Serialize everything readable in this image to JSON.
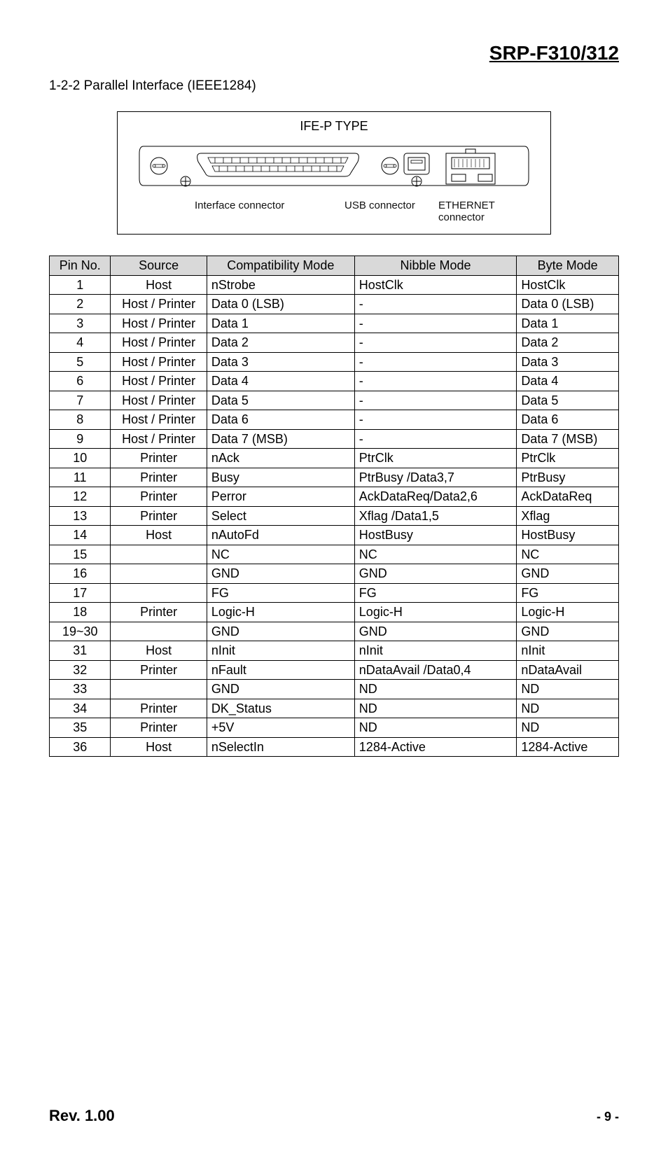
{
  "header": "SRP-F310/312",
  "sectionTitle": "1-2-2 Parallel Interface (IEEE1284)",
  "diagram": {
    "title": "IFE-P TYPE",
    "labels": {
      "interface": "Interface connector",
      "usb": "USB connector",
      "ethernet": "ETHERNET connector"
    }
  },
  "table": {
    "headers": [
      "Pin No.",
      "Source",
      "Compatibility Mode",
      "Nibble Mode",
      "Byte Mode"
    ],
    "rows": [
      {
        "pin": "1",
        "source": "Host",
        "comp": "nStrobe",
        "nibble": "HostClk",
        "byte": "HostClk"
      },
      {
        "pin": "2",
        "source": "Host / Printer",
        "comp": "Data 0 (LSB)",
        "nibble": "-",
        "byte": "Data 0 (LSB)"
      },
      {
        "pin": "3",
        "source": "Host / Printer",
        "comp": "Data 1",
        "nibble": "-",
        "byte": "Data 1"
      },
      {
        "pin": "4",
        "source": "Host / Printer",
        "comp": "Data 2",
        "nibble": "-",
        "byte": "Data 2"
      },
      {
        "pin": "5",
        "source": "Host / Printer",
        "comp": "Data 3",
        "nibble": "-",
        "byte": "Data 3"
      },
      {
        "pin": "6",
        "source": "Host / Printer",
        "comp": "Data 4",
        "nibble": "-",
        "byte": "Data 4"
      },
      {
        "pin": "7",
        "source": "Host / Printer",
        "comp": "Data 5",
        "nibble": "-",
        "byte": "Data 5"
      },
      {
        "pin": "8",
        "source": "Host / Printer",
        "comp": "Data 6",
        "nibble": "-",
        "byte": "Data 6"
      },
      {
        "pin": "9",
        "source": "Host / Printer",
        "comp": "Data 7 (MSB)",
        "nibble": "-",
        "byte": "Data 7 (MSB)"
      },
      {
        "pin": "10",
        "source": "Printer",
        "comp": "nAck",
        "nibble": "PtrClk",
        "byte": "PtrClk"
      },
      {
        "pin": "11",
        "source": "Printer",
        "comp": "Busy",
        "nibble": "PtrBusy /Data3,7",
        "byte": "PtrBusy"
      },
      {
        "pin": "12",
        "source": "Printer",
        "comp": "Perror",
        "nibble": "AckDataReq/Data2,6",
        "byte": "AckDataReq"
      },
      {
        "pin": "13",
        "source": "Printer",
        "comp": "Select",
        "nibble": "Xflag /Data1,5",
        "byte": "Xflag"
      },
      {
        "pin": "14",
        "source": "Host",
        "comp": "nAutoFd",
        "nibble": "HostBusy",
        "byte": "HostBusy"
      },
      {
        "pin": "15",
        "source": "",
        "comp": "NC",
        "nibble": "NC",
        "byte": "NC"
      },
      {
        "pin": "16",
        "source": "",
        "comp": "GND",
        "nibble": "GND",
        "byte": "GND"
      },
      {
        "pin": "17",
        "source": "",
        "comp": "FG",
        "nibble": "FG",
        "byte": "FG"
      },
      {
        "pin": "18",
        "source": "Printer",
        "comp": "Logic-H",
        "nibble": "Logic-H",
        "byte": "Logic-H"
      },
      {
        "pin": "19~30",
        "source": "",
        "comp": "GND",
        "nibble": "GND",
        "byte": "GND"
      },
      {
        "pin": "31",
        "source": "Host",
        "comp": "nInit",
        "nibble": "nInit",
        "byte": "nInit"
      },
      {
        "pin": "32",
        "source": "Printer",
        "comp": "nFault",
        "nibble": "nDataAvail /Data0,4",
        "byte": "nDataAvail"
      },
      {
        "pin": "33",
        "source": "",
        "comp": "GND",
        "nibble": "ND",
        "byte": "ND"
      },
      {
        "pin": "34",
        "source": "Printer",
        "comp": "DK_Status",
        "nibble": "ND",
        "byte": "ND"
      },
      {
        "pin": "35",
        "source": "Printer",
        "comp": "+5V",
        "nibble": "ND",
        "byte": "ND"
      },
      {
        "pin": "36",
        "source": "Host",
        "comp": "nSelectIn",
        "nibble": "1284-Active",
        "byte": "1284-Active"
      }
    ]
  },
  "footer": {
    "rev": "Rev. 1.00",
    "page": "- 9 -"
  }
}
